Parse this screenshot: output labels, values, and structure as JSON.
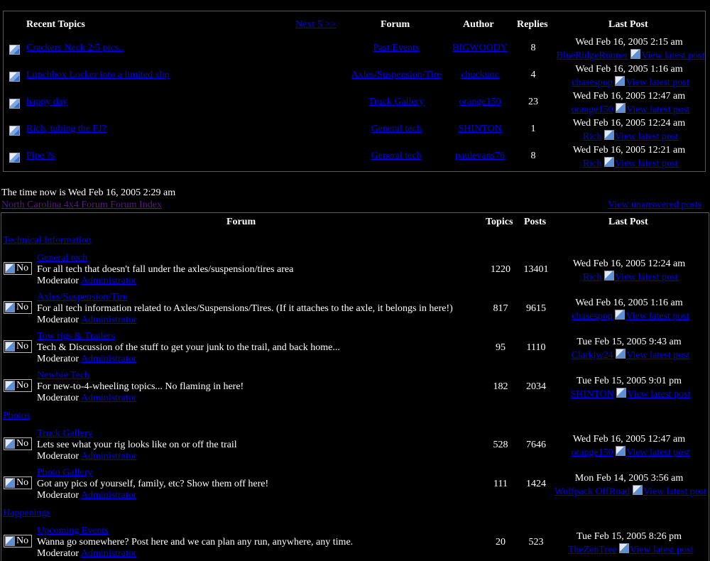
{
  "recent": {
    "headers": {
      "title": "Recent Topics",
      "next": "Next 5 >>",
      "forum": "Forum",
      "author": "Author",
      "replies": "Replies",
      "last_post": "Last Post"
    },
    "rows": [
      {
        "topic": "Crackers Neck 2/5 pics..",
        "forum": "Past Events",
        "author": "BIGWOODY",
        "replies": "8",
        "date": "Wed Feb 16, 2005 2:15 am",
        "poster": "BlueRidgeRunner",
        "view": "View latest post"
      },
      {
        "topic": "Lunchbox Locker into a limited slip",
        "forum": "Axles/Suspension/Tire",
        "author": "chuckunc",
        "replies": "4",
        "date": "Wed Feb 16, 2005 1:16 am",
        "poster": "chasespop",
        "view": "View latest post"
      },
      {
        "topic": "happy day",
        "forum": "Truck Gallery",
        "author": "orange150",
        "replies": "23",
        "date": "Wed Feb 16, 2005 12:47 am",
        "poster": "orange150",
        "view": "View latest post"
      },
      {
        "topic": "Rich, tubing the FJ?",
        "forum": "General tech",
        "author": "SHINTON",
        "replies": "1",
        "date": "Wed Feb 16, 2005 12:24 am",
        "poster": "Rich",
        "view": "View latest post"
      },
      {
        "topic": "Pipe ?s",
        "forum": "General tech",
        "author": "paulevans76",
        "replies": "8",
        "date": "Wed Feb 16, 2005 12:21 am",
        "poster": "Rich",
        "view": "View latest post"
      }
    ]
  },
  "time_now": "The time now is Wed Feb 16, 2005 2:29 am",
  "index_link": "North Carolina 4x4 Forum Forum Index",
  "unanswered": "View unanswered posts",
  "forums": {
    "headers": {
      "forum": "Forum",
      "topics": "Topics",
      "posts": "Posts",
      "last_post": "Last Post"
    },
    "moderator_label": "Moderator",
    "no_label": "No",
    "categories": [
      {
        "name": "Technical Information",
        "forums": [
          {
            "name": "General tech",
            "desc": "For all tech that doesn't fall under the axles/suspension/tires area",
            "moderator": "Administrator",
            "topics": "1220",
            "posts": "13401",
            "date": "Wed Feb 16, 2005 12:24 am",
            "poster": "Rich",
            "view": "View latest post"
          },
          {
            "name": "Axles/Suspension/Tire",
            "desc": "For all tech information related to Axles/Suspensions/Tires. (If it attaches to the axle, it belongs in here!)",
            "moderator": "Administrator",
            "topics": "817",
            "posts": "9615",
            "date": "Wed Feb 16, 2005 1:16 am",
            "poster": "chasespop",
            "view": "View latest post"
          },
          {
            "name": "Tow rigs & Trailers",
            "desc": "Tech & Discussion of the stuff to get your junk to the trail, and back home...",
            "moderator": "Administrator",
            "topics": "95",
            "posts": "1110",
            "date": "Tue Feb 15, 2005 9:43 am",
            "poster": "Clarkjw24",
            "view": "View latest post"
          },
          {
            "name": "Newbie Tech",
            "desc": "For new-to-4-wheeling topics... No flaming in here!",
            "moderator": "Administrator",
            "topics": "182",
            "posts": "2034",
            "date": "Tue Feb 15, 2005 9:01 pm",
            "poster": "SHINTON",
            "view": "View latest post"
          }
        ]
      },
      {
        "name": "Photos",
        "forums": [
          {
            "name": "Truck Gallery",
            "desc": "Lets see what your rig looks like on or off the trail",
            "moderator": "Administrator",
            "topics": "528",
            "posts": "7646",
            "date": "Wed Feb 16, 2005 12:47 am",
            "poster": "orange150",
            "view": "View latest post"
          },
          {
            "name": "Photo Gallery",
            "desc": "Got any pics of yourself, family, etc? Show them off here!",
            "moderator": "Administrator",
            "topics": "111",
            "posts": "1424",
            "date": "Mon Feb 14, 2005 3:56 am",
            "poster": "Wolfpack OffRoad",
            "view": "View latest post"
          }
        ]
      },
      {
        "name": "Happenings",
        "forums": [
          {
            "name": "Upcoming Events",
            "desc": "Wanna go somewhere? Post here and we can plan any run, anywhere, any time.",
            "moderator": "Administrator",
            "topics": "20",
            "posts": "523",
            "date": "Tue Feb 15, 2005 8:26 pm",
            "poster": "TheZenTree",
            "view": "View latest post"
          }
        ]
      }
    ]
  }
}
